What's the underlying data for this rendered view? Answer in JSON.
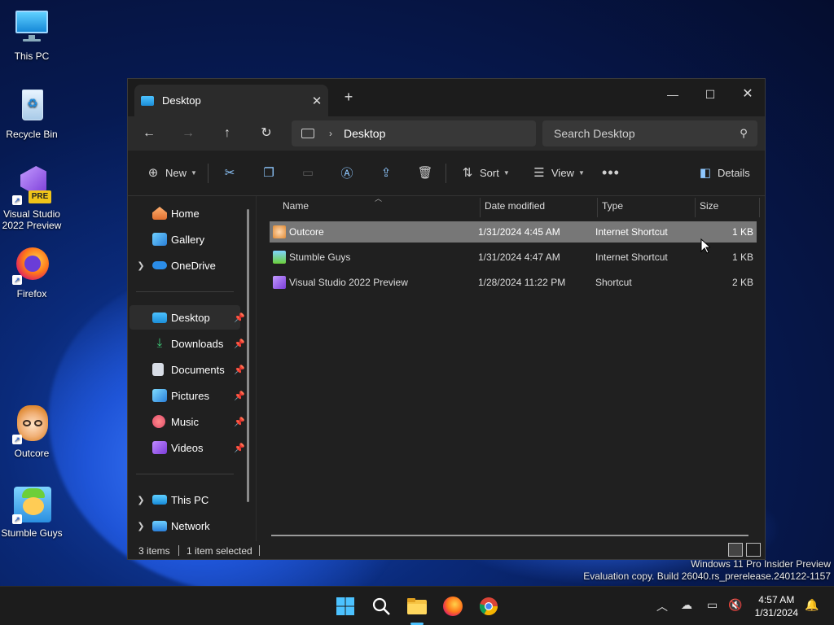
{
  "desktop": {
    "icons": [
      {
        "label": "This PC"
      },
      {
        "label": "Recycle Bin"
      },
      {
        "label": "Visual Studio 2022 Preview",
        "badge": "PRE"
      },
      {
        "label": "Firefox"
      },
      {
        "label": "Outcore"
      },
      {
        "label": "Stumble Guys"
      }
    ]
  },
  "window": {
    "tab_title": "Desktop",
    "address": {
      "crumb": "Desktop"
    },
    "search_placeholder": "Search Desktop",
    "toolbar": {
      "new_label": "New",
      "sort_label": "Sort",
      "view_label": "View",
      "details_label": "Details"
    },
    "sidebar": {
      "home": "Home",
      "gallery": "Gallery",
      "onedrive": "OneDrive",
      "quick": [
        {
          "label": "Desktop"
        },
        {
          "label": "Downloads"
        },
        {
          "label": "Documents"
        },
        {
          "label": "Pictures"
        },
        {
          "label": "Music"
        },
        {
          "label": "Videos"
        }
      ],
      "thispc": "This PC",
      "network": "Network"
    },
    "columns": {
      "name": "Name",
      "date": "Date modified",
      "type": "Type",
      "size": "Size"
    },
    "files": [
      {
        "name": "Outcore",
        "date": "1/31/2024 4:45 AM",
        "type": "Internet Shortcut",
        "size": "1 KB"
      },
      {
        "name": "Stumble Guys",
        "date": "1/31/2024 4:47 AM",
        "type": "Internet Shortcut",
        "size": "1 KB"
      },
      {
        "name": "Visual Studio 2022 Preview",
        "date": "1/28/2024 11:22 PM",
        "type": "Shortcut",
        "size": "2 KB"
      }
    ],
    "status": {
      "count": "3 items",
      "selected": "1 item selected"
    }
  },
  "watermark": {
    "line1": "Windows 11 Pro Insider Preview",
    "line2": "Evaluation copy. Build 26040.rs_prerelease.240122-1157"
  },
  "taskbar": {
    "time": "4:57 AM",
    "date": "1/31/2024"
  },
  "colors": {
    "accent": "#4cc2ff",
    "selection": "#777777",
    "window_bg": "#202020"
  }
}
